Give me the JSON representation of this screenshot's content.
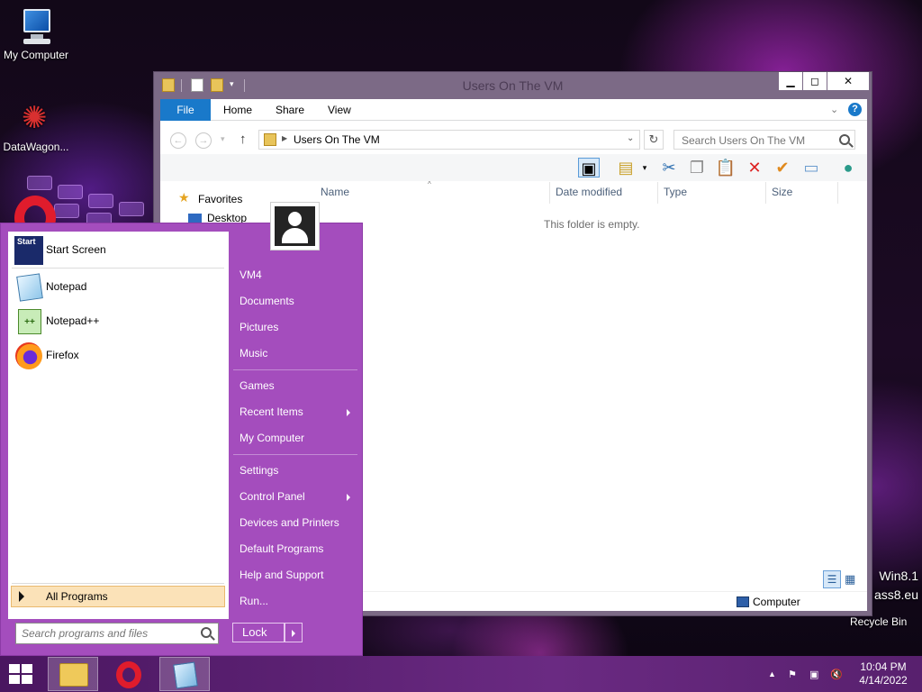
{
  "desktop": {
    "icons": [
      {
        "label": "My Computer"
      },
      {
        "label": "DataWagon..."
      },
      {
        "label": "Recycle Bin"
      }
    ],
    "watermark": [
      "Win8.1",
      "ass8.eu"
    ]
  },
  "explorer": {
    "title": "Users On The VM",
    "tabs": [
      "File",
      "Home",
      "Share",
      "View"
    ],
    "address": "Users On The VM",
    "search_placeholder": "Search Users On The VM",
    "nav": {
      "favorites": "Favorites",
      "desktop": "Desktop"
    },
    "columns": [
      "Name",
      "Date modified",
      "Type",
      "Size"
    ],
    "empty_message": "This folder is empty.",
    "status_location": "Computer"
  },
  "start_menu": {
    "pinned": [
      {
        "label": "Start Screen",
        "icon": "start-screen-icon"
      },
      {
        "label": "Notepad",
        "icon": "notepad-icon"
      },
      {
        "label": "Notepad++",
        "icon": "notepad-plus-plus-icon"
      },
      {
        "label": "Firefox",
        "icon": "firefox-icon"
      }
    ],
    "all_programs": "All Programs",
    "search_placeholder": "Search programs and files",
    "right_items": [
      {
        "label": "VM4"
      },
      {
        "label": "Documents"
      },
      {
        "label": "Pictures"
      },
      {
        "label": "Music"
      },
      {
        "label": "Games"
      },
      {
        "label": "Recent Items"
      },
      {
        "label": "My Computer"
      },
      {
        "label": "Settings"
      },
      {
        "label": "Control Panel"
      },
      {
        "label": "Devices and Printers"
      },
      {
        "label": "Default Programs"
      },
      {
        "label": "Help and Support"
      },
      {
        "label": "Run..."
      }
    ],
    "lock_label": "Lock"
  },
  "taskbar": {
    "apps": [
      "file-explorer-icon",
      "opera-icon",
      "notepad-icon"
    ],
    "time": "10:04 PM",
    "date": "4/14/2022"
  },
  "colors": {
    "accent": "#a44dbd",
    "file_tab": "#1979ca",
    "all_programs_bg": "#fbe2b8"
  }
}
